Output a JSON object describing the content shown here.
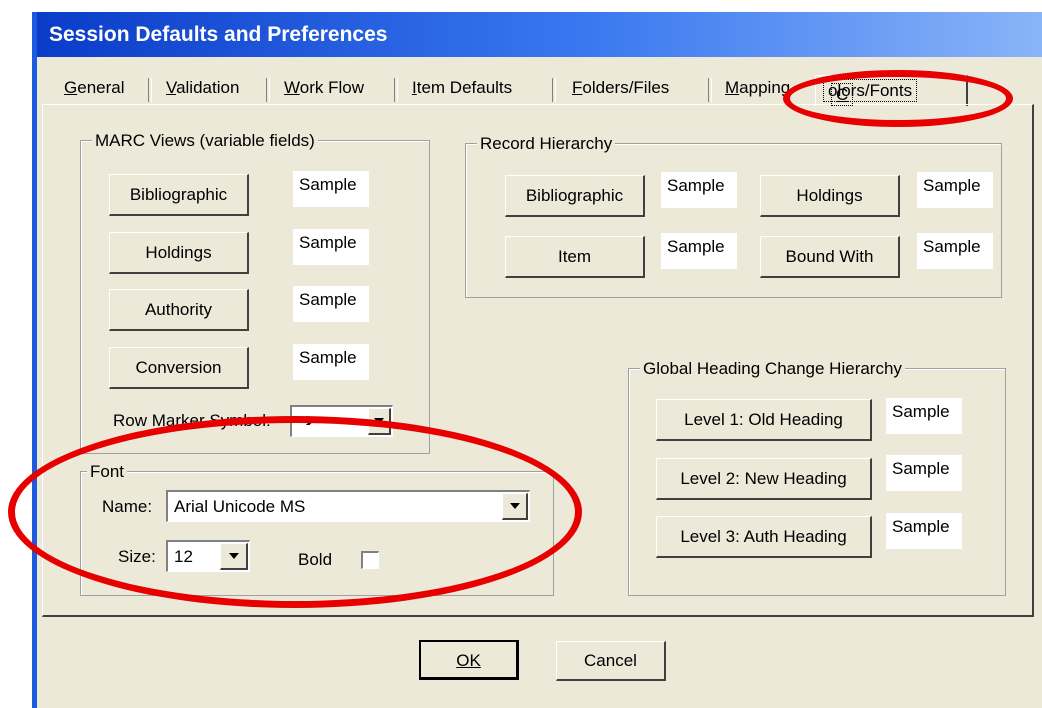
{
  "window": {
    "title": "Session Defaults and Preferences"
  },
  "tabs": [
    {
      "label": "General",
      "key": "G"
    },
    {
      "label": "Validation",
      "key": "V"
    },
    {
      "label": "Work Flow",
      "key": "W"
    },
    {
      "label": "Item Defaults",
      "key": "I"
    },
    {
      "label": "Folders/Files",
      "key": "F"
    },
    {
      "label": "Mapping",
      "key": "M"
    },
    {
      "label": "Colors/Fonts",
      "key": "C",
      "active": true
    }
  ],
  "marc_views": {
    "title": "MARC Views (variable fields)",
    "buttons": [
      {
        "label": "Bibliographic",
        "sample": "Sample"
      },
      {
        "label": "Holdings",
        "sample": "Sample"
      },
      {
        "label": "Authority",
        "sample": "Sample"
      },
      {
        "label": "Conversion",
        "sample": "Sample"
      }
    ],
    "row_marker_label": "Row Marker Symbol:",
    "row_marker_value": "➔"
  },
  "record_hierarchy": {
    "title": "Record Hierarchy",
    "buttons": [
      {
        "label": "Bibliographic",
        "sample": "Sample"
      },
      {
        "label": "Holdings",
        "sample": "Sample"
      },
      {
        "label": "Item",
        "sample": "Sample"
      },
      {
        "label": "Bound With",
        "sample": "Sample"
      }
    ]
  },
  "global_heading": {
    "title": "Global Heading Change Hierarchy",
    "buttons": [
      {
        "label": "Level 1: Old Heading",
        "sample": "Sample"
      },
      {
        "label": "Level 2: New Heading",
        "sample": "Sample"
      },
      {
        "label": "Level 3: Auth Heading",
        "sample": "Sample"
      }
    ]
  },
  "font": {
    "title": "Font",
    "name_label": "Name:",
    "name_value": "Arial Unicode MS",
    "size_label": "Size:",
    "size_value": "12",
    "bold_label": "Bold",
    "bold_checked": false
  },
  "dialog_buttons": {
    "ok": "OK",
    "cancel": "Cancel"
  },
  "colors": {
    "highlight": "#e60000",
    "titlebar": "#0a3cc8",
    "face": "#ece9d8"
  }
}
